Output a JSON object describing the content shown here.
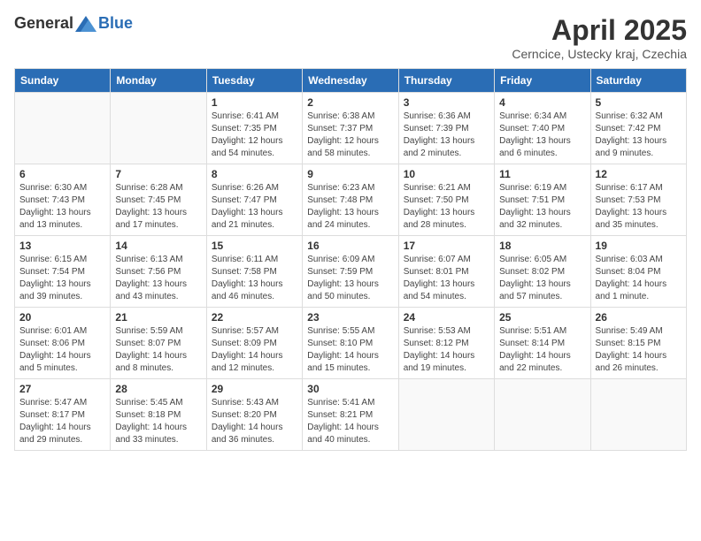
{
  "header": {
    "logo_general": "General",
    "logo_blue": "Blue",
    "month": "April 2025",
    "location": "Cerncice, Ustecky kraj, Czechia"
  },
  "weekdays": [
    "Sunday",
    "Monday",
    "Tuesday",
    "Wednesday",
    "Thursday",
    "Friday",
    "Saturday"
  ],
  "weeks": [
    [
      {
        "day": "",
        "info": ""
      },
      {
        "day": "",
        "info": ""
      },
      {
        "day": "1",
        "info": "Sunrise: 6:41 AM\nSunset: 7:35 PM\nDaylight: 12 hours\nand 54 minutes."
      },
      {
        "day": "2",
        "info": "Sunrise: 6:38 AM\nSunset: 7:37 PM\nDaylight: 12 hours\nand 58 minutes."
      },
      {
        "day": "3",
        "info": "Sunrise: 6:36 AM\nSunset: 7:39 PM\nDaylight: 13 hours\nand 2 minutes."
      },
      {
        "day": "4",
        "info": "Sunrise: 6:34 AM\nSunset: 7:40 PM\nDaylight: 13 hours\nand 6 minutes."
      },
      {
        "day": "5",
        "info": "Sunrise: 6:32 AM\nSunset: 7:42 PM\nDaylight: 13 hours\nand 9 minutes."
      }
    ],
    [
      {
        "day": "6",
        "info": "Sunrise: 6:30 AM\nSunset: 7:43 PM\nDaylight: 13 hours\nand 13 minutes."
      },
      {
        "day": "7",
        "info": "Sunrise: 6:28 AM\nSunset: 7:45 PM\nDaylight: 13 hours\nand 17 minutes."
      },
      {
        "day": "8",
        "info": "Sunrise: 6:26 AM\nSunset: 7:47 PM\nDaylight: 13 hours\nand 21 minutes."
      },
      {
        "day": "9",
        "info": "Sunrise: 6:23 AM\nSunset: 7:48 PM\nDaylight: 13 hours\nand 24 minutes."
      },
      {
        "day": "10",
        "info": "Sunrise: 6:21 AM\nSunset: 7:50 PM\nDaylight: 13 hours\nand 28 minutes."
      },
      {
        "day": "11",
        "info": "Sunrise: 6:19 AM\nSunset: 7:51 PM\nDaylight: 13 hours\nand 32 minutes."
      },
      {
        "day": "12",
        "info": "Sunrise: 6:17 AM\nSunset: 7:53 PM\nDaylight: 13 hours\nand 35 minutes."
      }
    ],
    [
      {
        "day": "13",
        "info": "Sunrise: 6:15 AM\nSunset: 7:54 PM\nDaylight: 13 hours\nand 39 minutes."
      },
      {
        "day": "14",
        "info": "Sunrise: 6:13 AM\nSunset: 7:56 PM\nDaylight: 13 hours\nand 43 minutes."
      },
      {
        "day": "15",
        "info": "Sunrise: 6:11 AM\nSunset: 7:58 PM\nDaylight: 13 hours\nand 46 minutes."
      },
      {
        "day": "16",
        "info": "Sunrise: 6:09 AM\nSunset: 7:59 PM\nDaylight: 13 hours\nand 50 minutes."
      },
      {
        "day": "17",
        "info": "Sunrise: 6:07 AM\nSunset: 8:01 PM\nDaylight: 13 hours\nand 54 minutes."
      },
      {
        "day": "18",
        "info": "Sunrise: 6:05 AM\nSunset: 8:02 PM\nDaylight: 13 hours\nand 57 minutes."
      },
      {
        "day": "19",
        "info": "Sunrise: 6:03 AM\nSunset: 8:04 PM\nDaylight: 14 hours\nand 1 minute."
      }
    ],
    [
      {
        "day": "20",
        "info": "Sunrise: 6:01 AM\nSunset: 8:06 PM\nDaylight: 14 hours\nand 5 minutes."
      },
      {
        "day": "21",
        "info": "Sunrise: 5:59 AM\nSunset: 8:07 PM\nDaylight: 14 hours\nand 8 minutes."
      },
      {
        "day": "22",
        "info": "Sunrise: 5:57 AM\nSunset: 8:09 PM\nDaylight: 14 hours\nand 12 minutes."
      },
      {
        "day": "23",
        "info": "Sunrise: 5:55 AM\nSunset: 8:10 PM\nDaylight: 14 hours\nand 15 minutes."
      },
      {
        "day": "24",
        "info": "Sunrise: 5:53 AM\nSunset: 8:12 PM\nDaylight: 14 hours\nand 19 minutes."
      },
      {
        "day": "25",
        "info": "Sunrise: 5:51 AM\nSunset: 8:14 PM\nDaylight: 14 hours\nand 22 minutes."
      },
      {
        "day": "26",
        "info": "Sunrise: 5:49 AM\nSunset: 8:15 PM\nDaylight: 14 hours\nand 26 minutes."
      }
    ],
    [
      {
        "day": "27",
        "info": "Sunrise: 5:47 AM\nSunset: 8:17 PM\nDaylight: 14 hours\nand 29 minutes."
      },
      {
        "day": "28",
        "info": "Sunrise: 5:45 AM\nSunset: 8:18 PM\nDaylight: 14 hours\nand 33 minutes."
      },
      {
        "day": "29",
        "info": "Sunrise: 5:43 AM\nSunset: 8:20 PM\nDaylight: 14 hours\nand 36 minutes."
      },
      {
        "day": "30",
        "info": "Sunrise: 5:41 AM\nSunset: 8:21 PM\nDaylight: 14 hours\nand 40 minutes."
      },
      {
        "day": "",
        "info": ""
      },
      {
        "day": "",
        "info": ""
      },
      {
        "day": "",
        "info": ""
      }
    ]
  ]
}
